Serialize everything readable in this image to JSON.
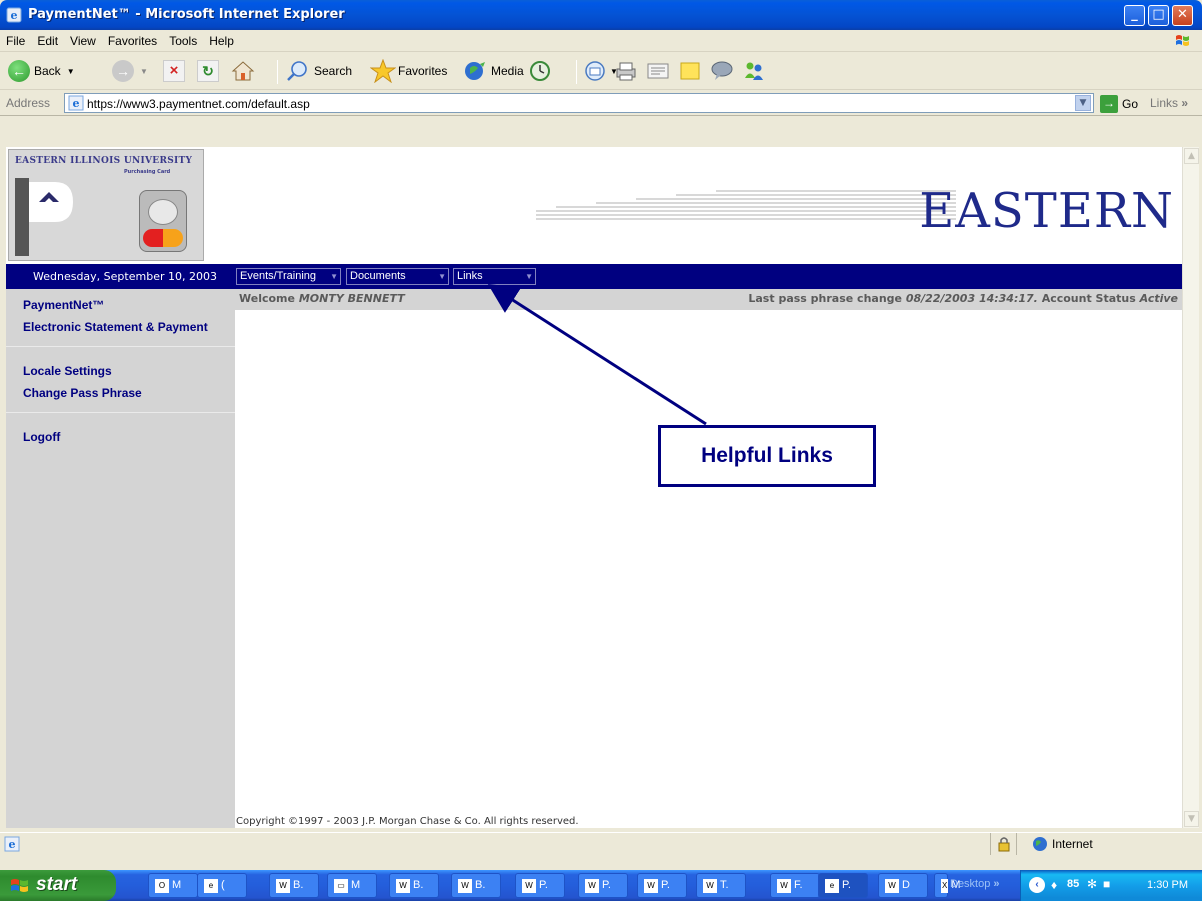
{
  "window": {
    "title": "PaymentNet™ - Microsoft Internet Explorer",
    "minimize": "_",
    "maximize": "□",
    "close": "✕"
  },
  "menu": [
    "File",
    "Edit",
    "View",
    "Favorites",
    "Tools",
    "Help"
  ],
  "toolbar": {
    "back": "Back",
    "search": "Search",
    "favorites": "Favorites",
    "media": "Media"
  },
  "address": {
    "label": "Address",
    "url": "https://www3.paymentnet.com/default.asp",
    "go": "Go",
    "links": "Links"
  },
  "page": {
    "eiu_name": "EASTERN ILLINOIS UNIVERSITY",
    "eiu_sub": "Purchasing Card",
    "eastern_logo": "EASTERN",
    "date": "Wednesday, September 10, 2003",
    "nav": [
      "Events/Training",
      "Documents",
      "Links"
    ],
    "sidebar": {
      "paymentnet": "PaymentNet™",
      "statement": "Electronic Statement & Payment",
      "locale": "Locale Settings",
      "passphrase": "Change Pass Phrase",
      "logoff": "Logoff"
    },
    "welcome_prefix": "Welcome",
    "user": "MONTY BENNETT",
    "status_prefix": "Last pass phrase change",
    "last_change": "08/22/2003 14:34:17.",
    "status_label": "Account Status",
    "status_value": "Active",
    "copyright": "Copyright ©1997 - 2003 J.P. Morgan Chase & Co. All rights reserved.",
    "callout": "Helpful Links"
  },
  "statusbar": {
    "zone": "Internet"
  },
  "taskbar": {
    "start": "start",
    "tasks": [
      {
        "icon": "O",
        "label": "M"
      },
      {
        "icon": "e",
        "label": "("
      },
      {
        "icon": "W",
        "label": "B."
      },
      {
        "icon": "▭",
        "label": "M"
      },
      {
        "icon": "W",
        "label": "B."
      },
      {
        "icon": "W",
        "label": "B."
      },
      {
        "icon": "W",
        "label": "P."
      },
      {
        "icon": "W",
        "label": "P."
      },
      {
        "icon": "W",
        "label": "P."
      },
      {
        "icon": "W",
        "label": "T."
      },
      {
        "icon": "W",
        "label": "F."
      },
      {
        "icon": "e",
        "label": "P."
      },
      {
        "icon": "W",
        "label": "D"
      },
      {
        "icon": "X",
        "label": "M"
      }
    ],
    "desktop": "Desktop",
    "clock": "1:30 PM"
  },
  "colors": {
    "navy": "#000080",
    "sidebar": "#D4D4D4",
    "xp_blue": "#0453D4"
  }
}
